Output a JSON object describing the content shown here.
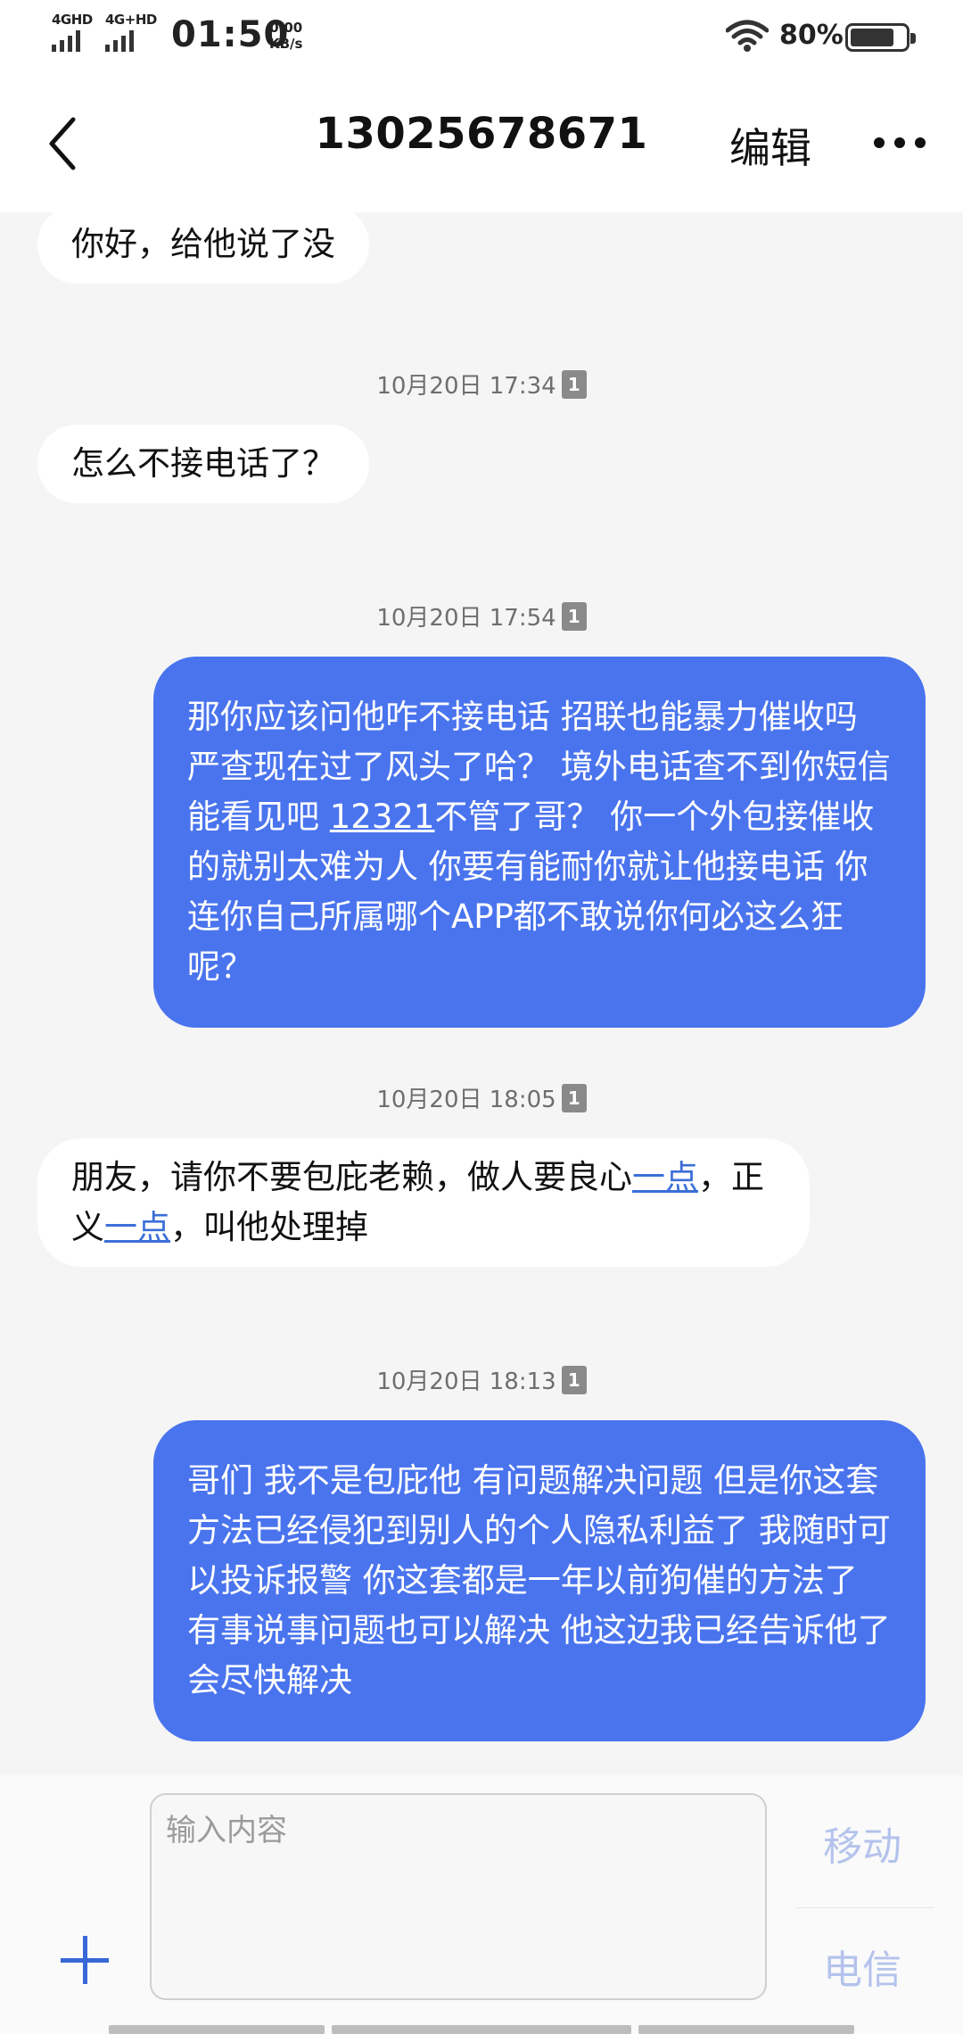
{
  "status_bar": {
    "network1": "4GHD",
    "network2": "4G+HD",
    "time": "01:50",
    "speed_value": "0.00",
    "speed_unit": "KB/s",
    "battery_percent": "80%",
    "battery_level": 0.8
  },
  "header": {
    "title": "13025678671",
    "edit_label": "编辑"
  },
  "messages": [
    {
      "type": "in",
      "parts": [
        {
          "text": "你好，给他说了没"
        }
      ]
    },
    {
      "type": "timestamp",
      "text": "10月20日 17:34",
      "sim": "1"
    },
    {
      "type": "in",
      "parts": [
        {
          "text": "怎么不接电话了？"
        }
      ]
    },
    {
      "type": "timestamp",
      "text": "10月20日 17:54",
      "sim": "1"
    },
    {
      "type": "out",
      "parts": [
        {
          "text": "那你应该问他咋不接电话 招联也能暴力催收吗 严查现在过了风头了哈？ 境外电话查不到你短信能看见吧 "
        },
        {
          "text": "12321",
          "link": true
        },
        {
          "text": "不管了哥？ 你一个外包接催收的就别太难为人 你要有能耐你就让他接电话 你连你自己所属哪个APP都不敢说你何必这么狂呢？"
        }
      ]
    },
    {
      "type": "timestamp",
      "text": "10月20日 18:05",
      "sim": "1"
    },
    {
      "type": "in",
      "parts": [
        {
          "text": "朋友，请你不要包庇老赖，做人要良心"
        },
        {
          "text": "一点",
          "link": true
        },
        {
          "text": "，正义"
        },
        {
          "text": "一点",
          "link": true
        },
        {
          "text": "，叫他处理掉"
        }
      ]
    },
    {
      "type": "timestamp",
      "text": "10月20日 18:13",
      "sim": "1"
    },
    {
      "type": "out",
      "parts": [
        {
          "text": "哥们 我不是包庇他 有问题解决问题 但是你这套方法已经侵犯到别人的个人隐私利益了 我随时可以投诉报警 你这套都是一年以前狗催的方法了 有事说事问题也可以解决 他这边我已经告诉他了 会尽快解决"
        }
      ]
    }
  ],
  "composer": {
    "placeholder": "输入内容",
    "sim1_label": "移动",
    "sim2_label": "电信"
  },
  "colors": {
    "outgoing_bubble": "#4a74ee",
    "accent": "#3a67d6",
    "sim_send_disabled": "#b4c3ec"
  }
}
